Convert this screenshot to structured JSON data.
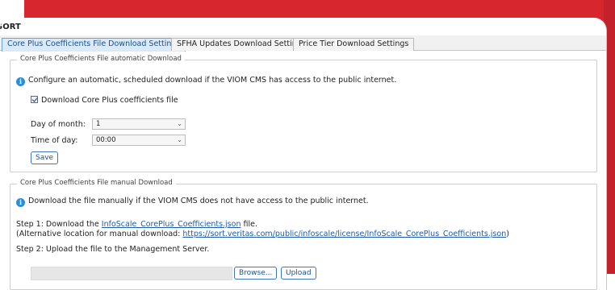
{
  "window": {
    "title": "SORT"
  },
  "colors": {
    "accent_red": "#d8262e",
    "tab_active_bg": "#dbeaf8",
    "link": "#1f5aa8",
    "info_icon": "#2b8fd6"
  },
  "tabs": [
    {
      "label": "Core Plus Coefficients File Download Settings",
      "active": true
    },
    {
      "label": "SFHA Updates Download Settings",
      "active": false
    },
    {
      "label": "Price Tier Download Settings",
      "active": false
    }
  ],
  "automatic": {
    "legend": "Core Plus Coefficients File automatic Download",
    "info_icon": "info-icon",
    "info_text": "Configure an automatic, scheduled download if the VIOM CMS has access to the public internet.",
    "checkbox_label": "Download Core Plus coefficients file",
    "checkbox_checked": true,
    "day_label": "Day of month:",
    "day_value": "1",
    "time_label": "Time of day:",
    "time_value": "00:00",
    "save_label": "Save"
  },
  "manual": {
    "legend": "Core Plus Coefficients File manual Download",
    "info_icon": "info-icon",
    "info_text": "Download the file manually if the VIOM CMS does not have access to the public internet.",
    "step1_prefix": "Step 1: Download the ",
    "step1_link": "InfoScale_CorePlus_Coefficients.json",
    "step1_suffix": " file.",
    "alt_prefix": "(Alternative location for manual download: ",
    "alt_link": "https://sort.veritas.com/public/infoscale/license/InfoScale_CorePlus_Coefficients.json",
    "alt_suffix": ")",
    "step2": "Step 2: Upload the file to the Management Server.",
    "browse_label": "Browse...",
    "upload_label": "Upload"
  }
}
